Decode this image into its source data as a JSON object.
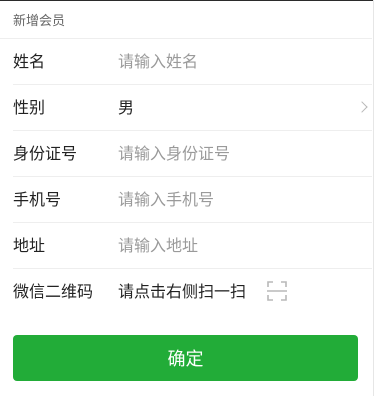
{
  "section_title": "新增会员",
  "fields": {
    "name": {
      "label": "姓名",
      "placeholder": "请输入姓名"
    },
    "gender": {
      "label": "性别",
      "value": "男"
    },
    "id_number": {
      "label": "身份证号",
      "placeholder": "请输入身份证号"
    },
    "phone": {
      "label": "手机号",
      "placeholder": "请输入手机号"
    },
    "address": {
      "label": "地址",
      "placeholder": "请输入地址"
    },
    "wechat_qr": {
      "label": "微信二维码",
      "hint": "请点击右侧扫一扫"
    }
  },
  "confirm_label": "确定",
  "colors": {
    "primary": "#22ac38",
    "placeholder": "#9a9a9a",
    "divider": "#eeeeee"
  },
  "icons": {
    "gender_row": "chevron-right-icon",
    "wechat_row": "scan-icon"
  }
}
